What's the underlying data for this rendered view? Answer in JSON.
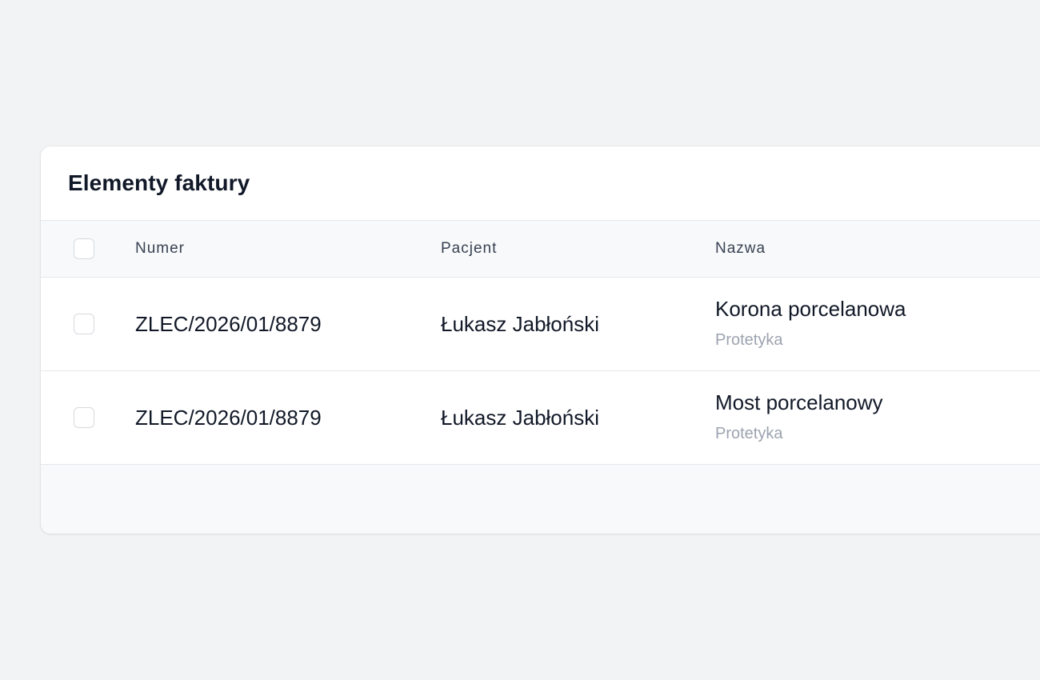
{
  "card": {
    "title": "Elementy faktury"
  },
  "table": {
    "columns": {
      "numer": "Numer",
      "pacjent": "Pacjent",
      "nazwa": "Nazwa"
    },
    "rows": [
      {
        "numer": "ZLEC/2026/01/8879",
        "pacjent": "Łukasz Jabłoński",
        "nazwa": "Korona porcelanowa",
        "kategoria": "Protetyka"
      },
      {
        "numer": "ZLEC/2026/01/8879",
        "pacjent": "Łukasz Jabłoński",
        "nazwa": "Most porcelanowy",
        "kategoria": "Protetyka"
      }
    ]
  }
}
